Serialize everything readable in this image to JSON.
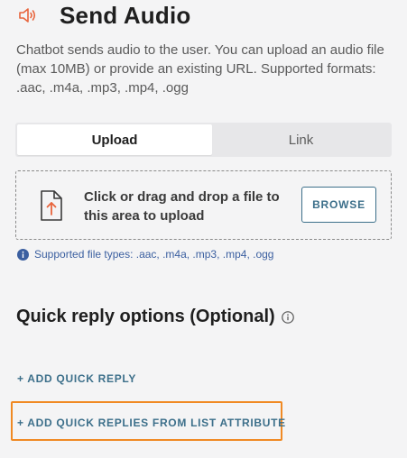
{
  "header": {
    "icon": "speaker-icon",
    "title": "Send Audio"
  },
  "description": "Chatbot sends audio to the user. You can upload an audio file (max 10MB) or provide an existing URL. Supported formats: .aac, .m4a, .mp3, .mp4, .ogg",
  "tabs": [
    {
      "label": "Upload",
      "active": true
    },
    {
      "label": "Link",
      "active": false
    }
  ],
  "dropzone": {
    "icon": "file-upload-icon",
    "text": "Click or drag and drop a file to this area to upload",
    "browse_label": "BROWSE"
  },
  "supported_note": {
    "icon": "info-icon",
    "text": "Supported file types: .aac, .m4a, .mp3, .mp4, .ogg"
  },
  "quick_reply": {
    "title": "Quick reply options (Optional)",
    "help_icon": "help-circle-icon",
    "add_label": "+ ADD QUICK REPLY",
    "add_from_list_label": "+ ADD QUICK REPLIES FROM LIST ATTRIBUTE"
  },
  "colors": {
    "accent": "#3c6f8a",
    "highlight": "#f08a24",
    "speaker": "#e8643c",
    "info": "#3b5fa0"
  }
}
